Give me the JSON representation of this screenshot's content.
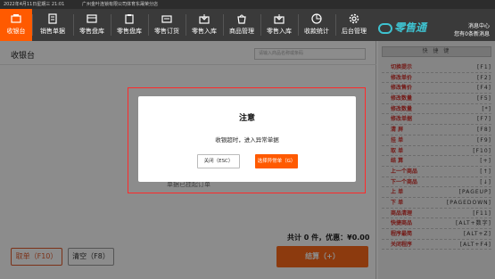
{
  "titlebar": {
    "datetime": "2022年4月11日星期三 21:01",
    "company": "广州金叶连锁有限公司体育东晟荣分店"
  },
  "nav": {
    "items": [
      {
        "label": "收银台",
        "icon": "cashier-icon"
      },
      {
        "label": "销售单据",
        "icon": "receipt-icon"
      },
      {
        "label": "零售盘库",
        "icon": "inventory-icon"
      },
      {
        "label": "零售盘库",
        "icon": "clipboard-icon"
      },
      {
        "label": "零售订货",
        "icon": "order-icon"
      },
      {
        "label": "零售入库",
        "icon": "stock-in-icon"
      },
      {
        "label": "商品管理",
        "icon": "goods-icon"
      },
      {
        "label": "零售入库",
        "icon": "stock-in-icon"
      },
      {
        "label": "收款统计",
        "icon": "statistics-icon"
      },
      {
        "label": "后台管理",
        "icon": "gear-icon"
      }
    ]
  },
  "brand": {
    "name": "零售通"
  },
  "user": {
    "line1": "消息中心",
    "line2": "您有0条新消息"
  },
  "main": {
    "title": "收银台",
    "search_placeholder": "请输入商品名称或条码",
    "ghost_text": "单据已挂起订单",
    "totals": "共计 0 件，优惠：¥0.00",
    "take_label": "取单（F10）",
    "clear_label": "清空（F8）",
    "pay_label": "结算（+）"
  },
  "side": {
    "header": "快 捷 键",
    "items": [
      {
        "name": "切换提示",
        "key": "[F1]"
      },
      {
        "name": "修改单价",
        "key": "[F2]"
      },
      {
        "name": "修改售价",
        "key": "[F4]"
      },
      {
        "name": "修改数量",
        "key": "[F5]"
      },
      {
        "name": "修改数量",
        "key": "[*]"
      },
      {
        "name": "修改单据",
        "key": "[F7]"
      },
      {
        "name": "清 屏",
        "key": "[F8]"
      },
      {
        "name": "挂 单",
        "key": "[F9]"
      },
      {
        "name": "取 单",
        "key": "[F10]"
      },
      {
        "name": "结 算",
        "key": "[+]"
      },
      {
        "name": "上一个商品",
        "key": "[↑]"
      },
      {
        "name": "下一个商品",
        "key": "[↓]"
      },
      {
        "name": "上 单",
        "key": "[PAGEUP]"
      },
      {
        "name": "下 单",
        "key": "[PAGEDOWN]"
      },
      {
        "name": "商品清理",
        "key": "[F11]"
      },
      {
        "name": "快捷商品",
        "key": "[ALT+数字]"
      },
      {
        "name": "程序最简",
        "key": "[ALT+Z]"
      },
      {
        "name": "关闭程序",
        "key": "[ALT+F4]"
      }
    ]
  },
  "dialog": {
    "title": "注意",
    "message": "收银超时，进入异常单据",
    "close_label": "关闭（ESC）",
    "ok_label": "选择异常单（G）"
  },
  "colors": {
    "accent": "#ff5a00",
    "nav_bg": "#3a3a3a",
    "shortcut_red": "#d2302a",
    "highlight": "#ff2a2a"
  }
}
